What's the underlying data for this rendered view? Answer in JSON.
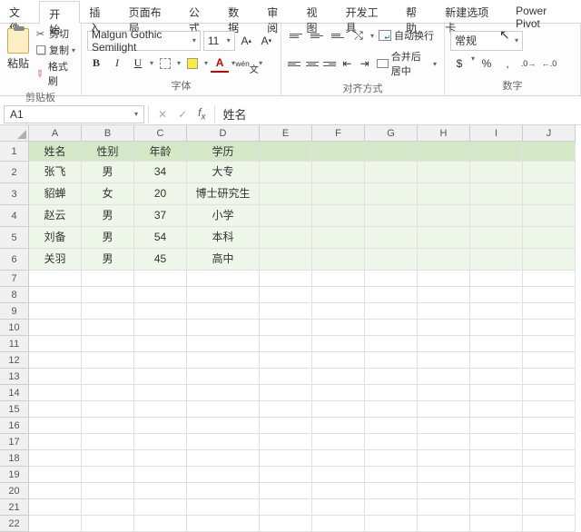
{
  "tabs": [
    "文件",
    "开始",
    "插入",
    "页面布局",
    "公式",
    "数据",
    "审阅",
    "视图",
    "开发工具",
    "帮助",
    "新建选项卡",
    "Power Pivot"
  ],
  "active_tab": 1,
  "clipboard": {
    "paste": "粘贴",
    "cut": "剪切",
    "copy": "复制",
    "format_painter": "格式刷",
    "label": "剪贴板"
  },
  "font": {
    "name": "Malgun Gothic Semilight",
    "size": "11",
    "label": "字体"
  },
  "align": {
    "wrap": "自动换行",
    "merge": "合并后居中",
    "label": "对齐方式"
  },
  "number": {
    "format": "常规",
    "label": "数字"
  },
  "name_box": "A1",
  "formula_value": "姓名",
  "columns": [
    "A",
    "B",
    "C",
    "D",
    "E",
    "F",
    "G",
    "H",
    "I",
    "J"
  ],
  "row_count": 22,
  "header_row": [
    "姓名",
    "性别",
    "年龄",
    "学历"
  ],
  "data_rows": [
    [
      "张飞",
      "男",
      "34",
      "大专"
    ],
    [
      "貂蝉",
      "女",
      "20",
      "博士研究生"
    ],
    [
      "赵云",
      "男",
      "37",
      "小学"
    ],
    [
      "刘备",
      "男",
      "54",
      "本科"
    ],
    [
      "关羽",
      "男",
      "45",
      "高中"
    ]
  ],
  "chart_data": {
    "type": "table",
    "columns": [
      "姓名",
      "性别",
      "年龄",
      "学历"
    ],
    "rows": [
      {
        "姓名": "张飞",
        "性别": "男",
        "年龄": 34,
        "学历": "大专"
      },
      {
        "姓名": "貂蝉",
        "性别": "女",
        "年龄": 20,
        "学历": "博士研究生"
      },
      {
        "姓名": "赵云",
        "性别": "男",
        "年龄": 37,
        "学历": "小学"
      },
      {
        "姓名": "刘备",
        "性别": "男",
        "年龄": 54,
        "学历": "本科"
      },
      {
        "姓名": "关羽",
        "性别": "男",
        "年龄": 45,
        "学历": "高中"
      }
    ]
  }
}
